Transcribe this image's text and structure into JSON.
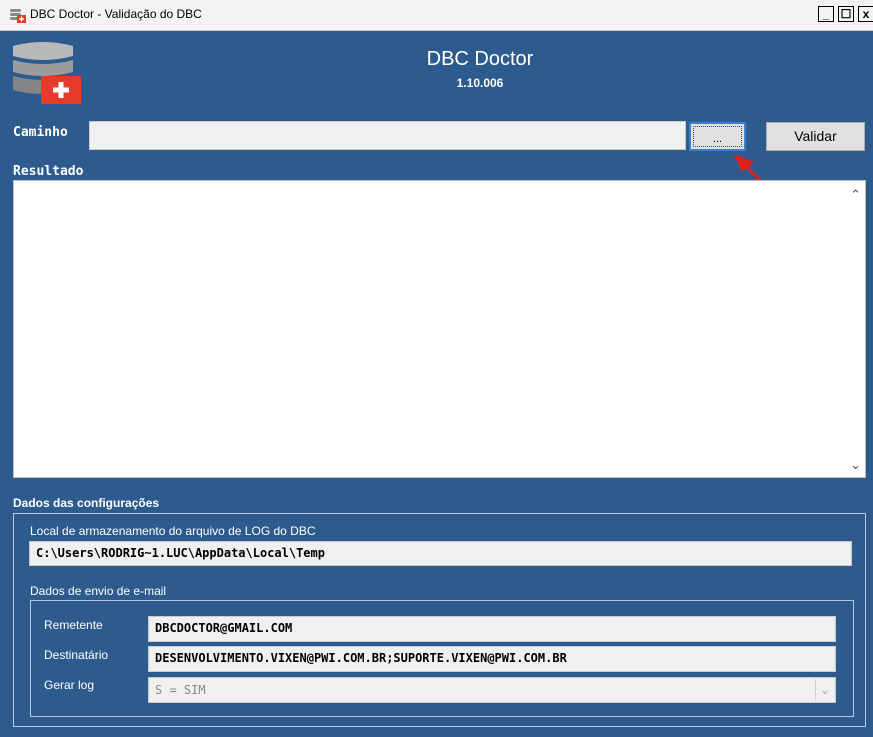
{
  "window": {
    "title": "DBC Doctor - Validação do DBC",
    "minimize": "_",
    "maximize": "☐",
    "close": "x"
  },
  "header": {
    "app_name": "DBC Doctor",
    "version": "1.10.006"
  },
  "path": {
    "label": "Caminho",
    "value": "",
    "browse_label": "...",
    "validate_label": "Validar"
  },
  "result": {
    "label": "Resultado",
    "content": "",
    "scroll_up": "⌃",
    "scroll_down": "⌄"
  },
  "config": {
    "section_title": "Dados das configurações",
    "log_group_label": "Local de armazenamento do arquivo de LOG do DBC",
    "log_path": "C:\\Users\\RODRIG~1.LUC\\AppData\\Local\\Temp",
    "email_group_label": "Dados de envio de e-mail",
    "sender_label": "Remetente",
    "sender_value": "DBCDOCTOR@GMAIL.COM",
    "recipient_label": "Destinatário",
    "recipient_value": "DESENVOLVIMENTO.VIXEN@PWI.COM.BR;SUPORTE.VIXEN@PWI.COM.BR",
    "log_label": "Gerar log",
    "log_value": "S = SIM",
    "log_arrow": "⌄"
  },
  "colors": {
    "background": "#2e5b8e",
    "annotation_arrow": "#e0201b",
    "focus_border": "#3c7fd1"
  },
  "icons": {
    "app": "database-medical-icon",
    "annotation": "red-arrow-icon"
  }
}
